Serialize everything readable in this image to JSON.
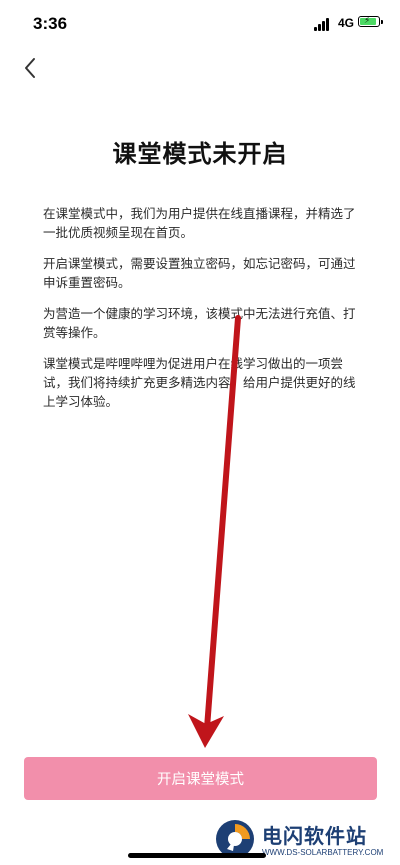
{
  "status_bar": {
    "time": "3:36",
    "network": "4G"
  },
  "header": {
    "back_icon": "chevron-left-icon"
  },
  "page": {
    "title": "课堂模式未开启",
    "paragraphs": [
      "在课堂模式中，我们为用户提供在线直播课程，并精选了一批优质视频呈现在首页。",
      "开启课堂模式，需要设置独立密码，如忘记密码，可通过申诉重置密码。",
      "为营造一个健康的学习环境，该模式中无法进行充值、打赏等操作。",
      "课堂模式是哔哩哔哩为促进用户在线学习做出的一项尝试，我们将持续扩充更多精选内容，给用户提供更好的线上学习体验。"
    ]
  },
  "actions": {
    "enable_button_label": "开启课堂模式"
  },
  "watermark": {
    "name": "电闪软件站",
    "url": "WWW.DS-SOLARBATTERY.COM"
  },
  "colors": {
    "button": "#f28fab",
    "annotation_arrow": "#c0151b",
    "battery": "#4cd964"
  }
}
